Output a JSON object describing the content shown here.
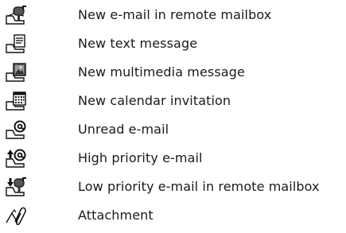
{
  "legend": {
    "items": [
      {
        "icon": "remote-mailbox-new-email-icon",
        "label": "New e-mail in remote mailbox"
      },
      {
        "icon": "new-text-message-icon",
        "label": "New text message"
      },
      {
        "icon": "new-multimedia-message-icon",
        "label": "New multimedia message"
      },
      {
        "icon": "new-calendar-invitation-icon",
        "label": "New calendar invitation"
      },
      {
        "icon": "unread-email-icon",
        "label": "Unread e-mail"
      },
      {
        "icon": "high-priority-email-icon",
        "label": "High priority e-mail"
      },
      {
        "icon": "low-priority-remote-mailbox-email-icon",
        "label": "Low priority e-mail in remote mailbox"
      },
      {
        "icon": "attachment-icon",
        "label": "Attachment"
      }
    ]
  }
}
